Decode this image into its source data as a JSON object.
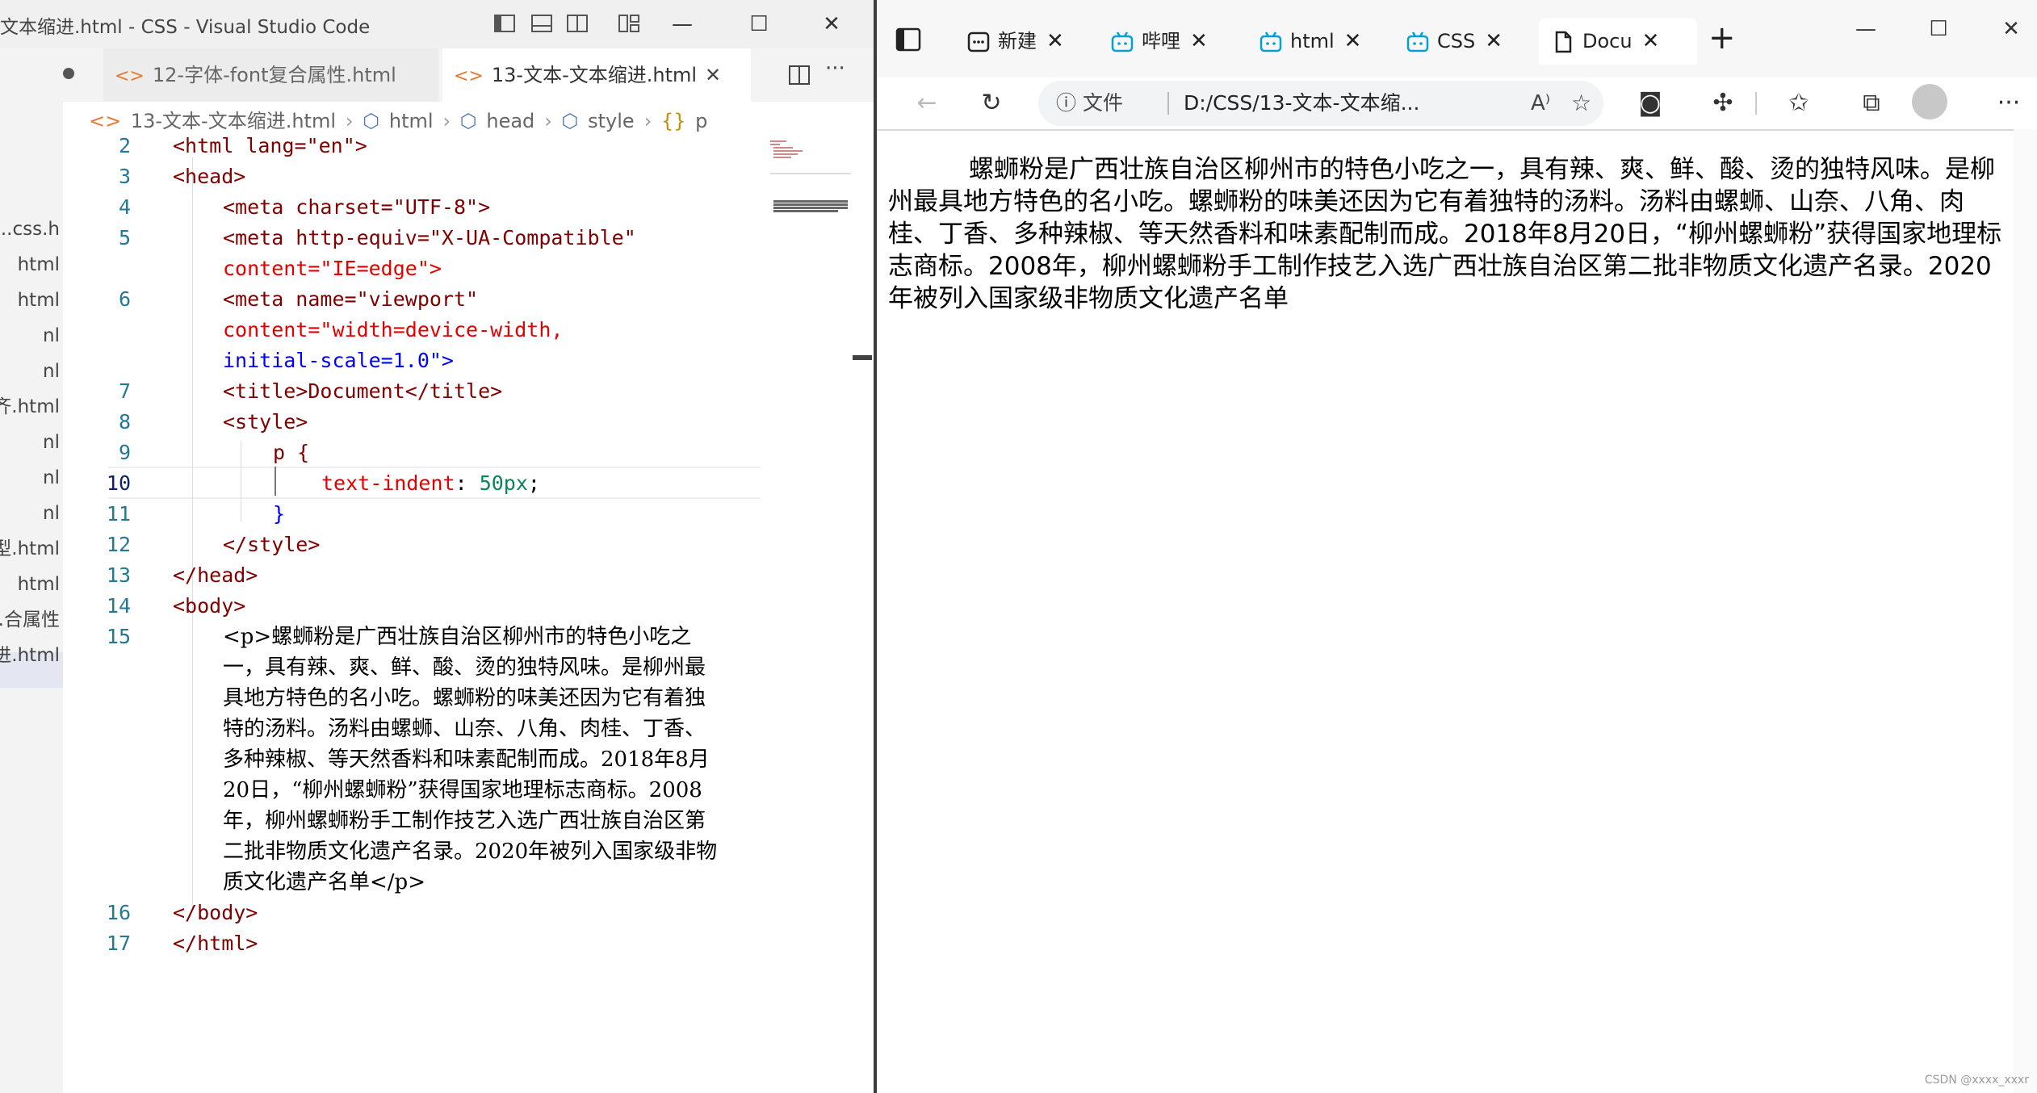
{
  "vscode": {
    "window_title": "文本缩进.html - CSS - Visual Studio Code",
    "tabs": [
      {
        "label": "12-字体-font复合属性.html",
        "active": false
      },
      {
        "label": "13-文本-文本缩进.html",
        "active": true
      }
    ],
    "breadcrumb": [
      "13-文本-文本缩进.html",
      "html",
      "head",
      "style",
      "p"
    ],
    "explorer_items": [
      "css.h...",
      "html",
      "html",
      "nl",
      "nl",
      "齐.html",
      "nl",
      "nl",
      "nl",
      "型.html",
      "html",
      "合属性...",
      "进.html"
    ],
    "line_numbers": [
      "2",
      "3",
      "4",
      "5",
      "6",
      "7",
      "8",
      "9",
      "10",
      "11",
      "12",
      "13",
      "14",
      "15",
      "16",
      "17"
    ],
    "code": {
      "l2": "<html lang=\"en\">",
      "l3": "<head>",
      "l4": "<meta charset=\"UTF-8\">",
      "l5a": "<meta http-equiv=\"X-UA-Compatible\"",
      "l5b": "content=\"IE=edge\">",
      "l6a": "<meta name=\"viewport\"",
      "l6b": "content=\"width=device-width,",
      "l6c": "initial-scale=1.0\">",
      "l7": "<title>Document</title>",
      "l8": "<style>",
      "l9": "p {",
      "l10_prop": "text-indent",
      "l10_val": "50px",
      "l11": "}",
      "l12": "</style>",
      "l13": "</head>",
      "l14": "<body>",
      "l15": [
        "<p>螺蛳粉是广西壮族自治区柳州市的特色小吃之",
        "一，具有辣、爽、鲜、酸、烫的独特风味。是柳州最",
        "具地方特色的名小吃。螺蛳粉的味美还因为它有着独",
        "特的汤料。汤料由螺蛳、山奈、八角、肉桂、丁香、",
        "多种辣椒、等天然香料和味素配制而成。2018年8月",
        "20日，“柳州螺蛳粉”获得国家地理标志商标。2008",
        "年，柳州螺蛳粉手工制作技艺入选广西壮族自治区第",
        "二批非物质文化遗产名录。2020年被列入国家级非物",
        "质文化遗产名单</p>"
      ],
      "l16": "</body>",
      "l17": "</html>"
    }
  },
  "edge": {
    "tabs": [
      {
        "label": "新建",
        "icon": "new-tab-icon"
      },
      {
        "label": "哔哩",
        "icon": "bilibili-icon"
      },
      {
        "label": "html",
        "icon": "bilibili-icon"
      },
      {
        "label": "CSS",
        "icon": "bilibili-icon"
      },
      {
        "label": "Docu",
        "icon": "document-icon",
        "active": true
      }
    ],
    "address_info": "文件",
    "address": "D:/CSS/13-文本-文本缩...",
    "page_paragraph": "螺蛳粉是广西壮族自治区柳州市的特色小吃之一，具有辣、爽、鲜、酸、烫的独特风味。是柳州最具地方特色的名小吃。螺蛳粉的味美还因为它有着独特的汤料。汤料由螺蛳、山奈、八角、肉桂、丁香、多种辣椒、等天然香料和味素配制而成。2018年8月20日，“柳州螺蛳粉”获得国家地理标志商标。2008年，柳州螺蛳粉手工制作技艺入选广西壮族自治区第二批非物质文化遗产名录。2020年被列入国家级非物质文化遗产名单"
  },
  "watermark": "CSDN @xxxx_xxxr"
}
